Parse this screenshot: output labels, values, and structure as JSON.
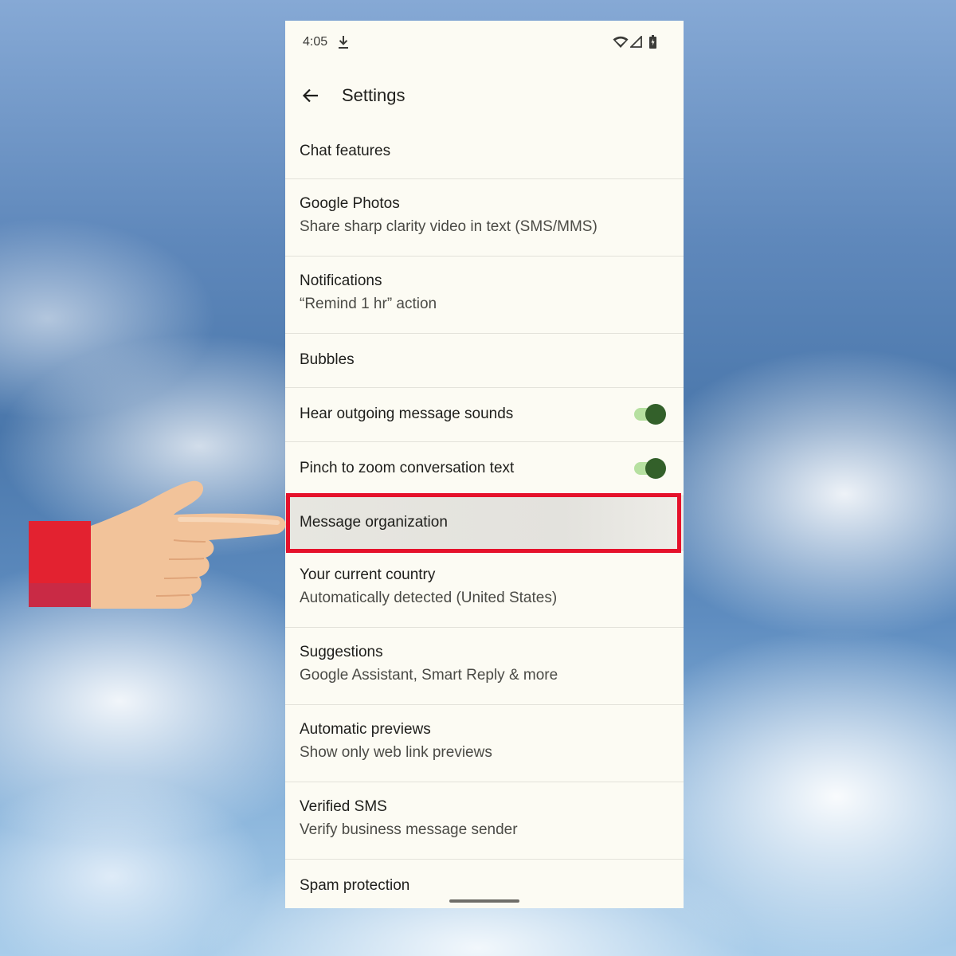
{
  "status_bar": {
    "time": "4:05",
    "icons": [
      "download-icon",
      "wifi-icon",
      "signal-icon",
      "battery-icon"
    ]
  },
  "app_bar": {
    "back_icon": "arrow-left-icon",
    "title": "Settings"
  },
  "settings": {
    "chat_features": {
      "title": "Chat features"
    },
    "google_photos": {
      "title": "Google Photos",
      "subtitle": "Share sharp clarity video in text (SMS/MMS)"
    },
    "notifications": {
      "title": "Notifications",
      "subtitle": "“Remind 1 hr” action"
    },
    "bubbles": {
      "title": "Bubbles"
    },
    "hear_sounds": {
      "title": "Hear outgoing message sounds",
      "toggle_on": true
    },
    "pinch_zoom": {
      "title": "Pinch to zoom conversation text",
      "toggle_on": true
    },
    "message_organization": {
      "title": "Message organization",
      "highlighted": true
    },
    "current_country": {
      "title": "Your current country",
      "subtitle": "Automatically detected (United States)"
    },
    "suggestions": {
      "title": "Suggestions",
      "subtitle": "Google Assistant, Smart Reply & more"
    },
    "automatic_previews": {
      "title": "Automatic previews",
      "subtitle": "Show only web link previews"
    },
    "verified_sms": {
      "title": "Verified SMS",
      "subtitle": "Verify business message sender"
    },
    "spam_protection": {
      "title": "Spam protection"
    }
  },
  "colors": {
    "highlight_border": "#e5112b",
    "toggle_thumb": "#33602a",
    "toggle_track": "#b6e0a0",
    "screen_background": "#fcfbf3",
    "sleeve": "#e32230",
    "skin": "#f2c39a"
  },
  "annotation": {
    "pointer": "pointing-hand-icon"
  }
}
